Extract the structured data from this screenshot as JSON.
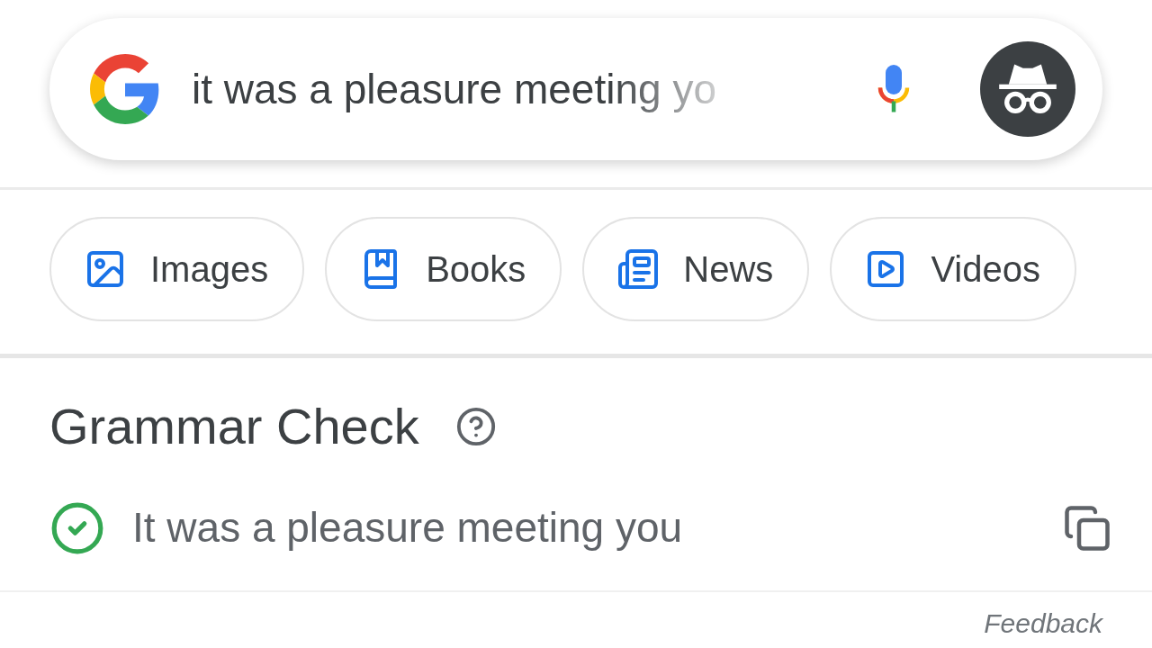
{
  "search": {
    "value": "it was a pleasure meeting yo"
  },
  "chips": [
    {
      "kind": "images",
      "label": "Images"
    },
    {
      "kind": "books",
      "label": "Books"
    },
    {
      "kind": "news",
      "label": "News"
    },
    {
      "kind": "videos",
      "label": "Videos"
    }
  ],
  "grammar": {
    "title": "Grammar Check",
    "result": "It was a pleasure meeting you",
    "correct": true,
    "feedback": "Feedback"
  }
}
